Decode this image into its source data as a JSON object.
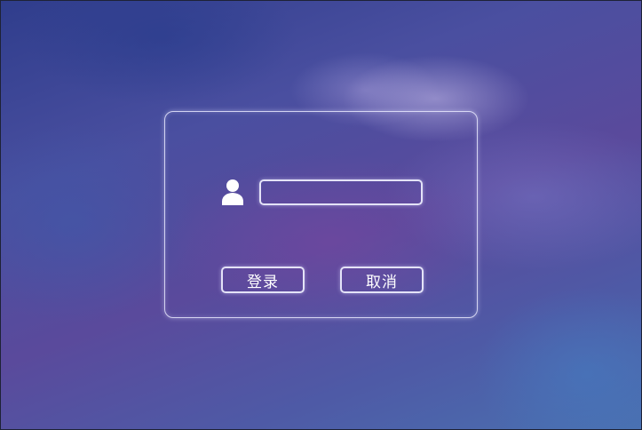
{
  "colors": {
    "panel_border": "#ebebff",
    "text": "#ffffff",
    "background_top": "#2f3d8c",
    "background_bottom": "#4a70b0"
  },
  "login": {
    "icon": "user-icon",
    "username": {
      "value": "",
      "placeholder": ""
    },
    "buttons": {
      "login_label": "登录",
      "cancel_label": "取消"
    }
  }
}
